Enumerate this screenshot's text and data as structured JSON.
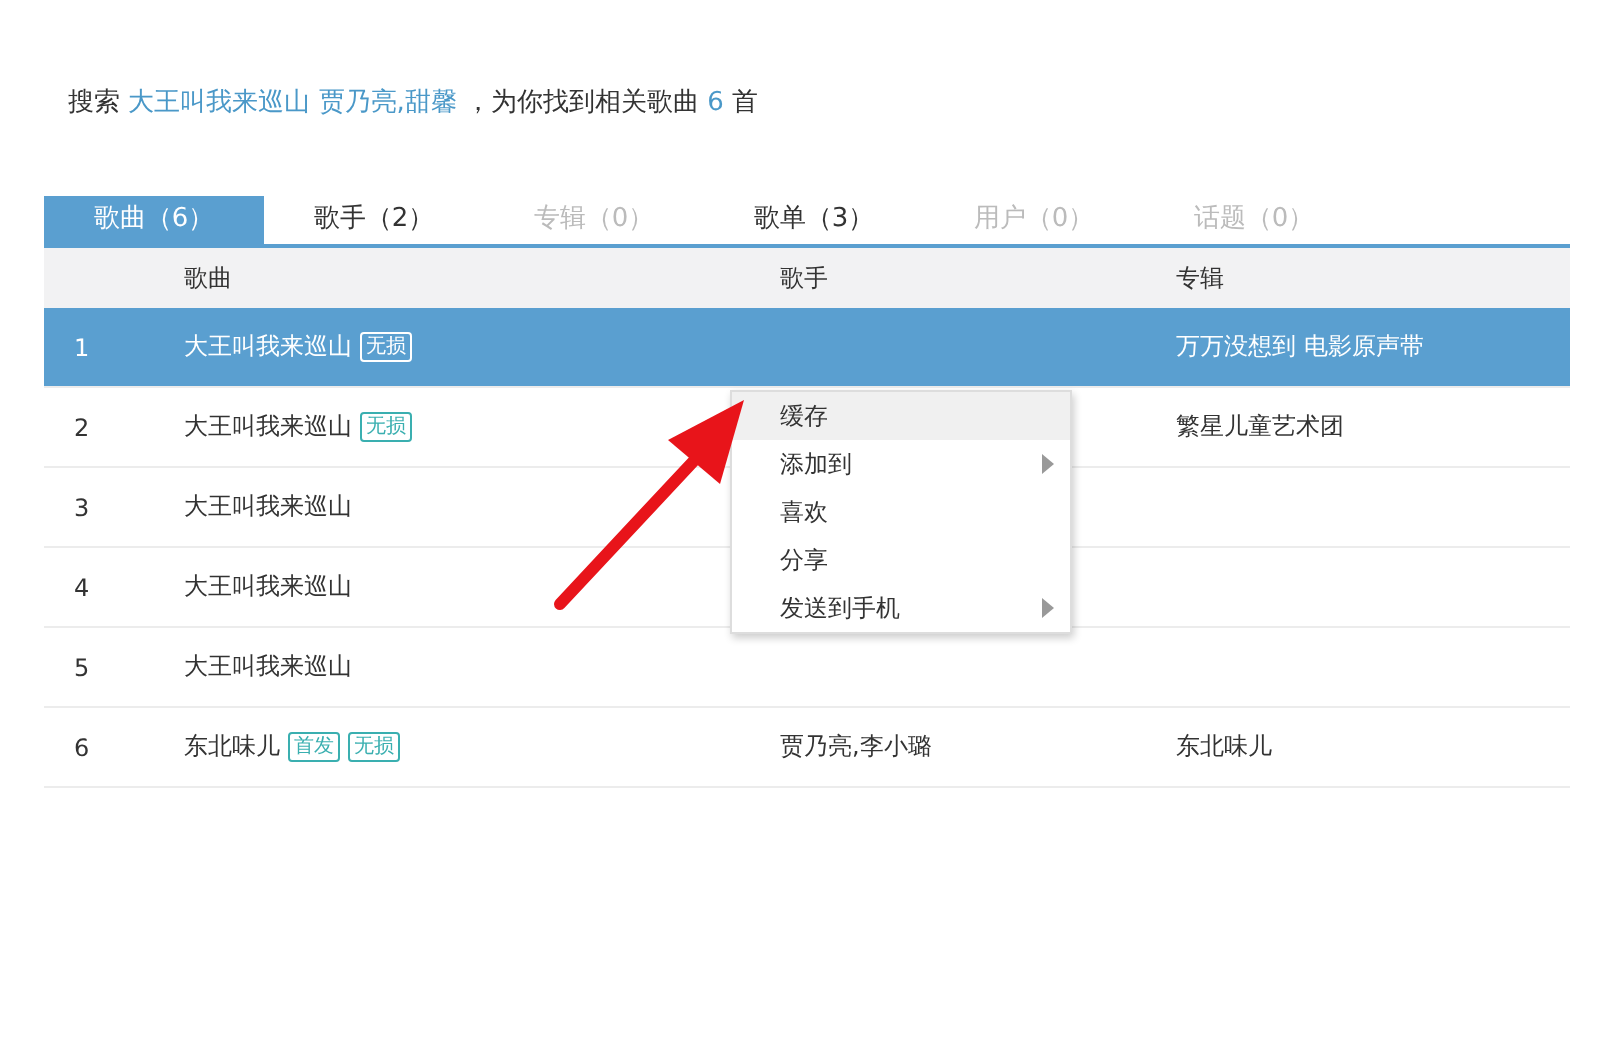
{
  "summary": {
    "prefix": "搜索",
    "query": "大王叫我来巡山 贾乃亮,甜馨",
    "middle": "，为你找到相关歌曲",
    "count": "6",
    "unit": "首"
  },
  "tabs": [
    {
      "label": "歌曲（6）",
      "selected": true,
      "disabled": false
    },
    {
      "label": "歌手（2）",
      "selected": false,
      "disabled": false
    },
    {
      "label": "专辑（0）",
      "selected": false,
      "disabled": true
    },
    {
      "label": "歌单（3）",
      "selected": false,
      "disabled": false
    },
    {
      "label": "用户（0）",
      "selected": false,
      "disabled": true
    },
    {
      "label": "话题（0）",
      "selected": false,
      "disabled": true
    }
  ],
  "table": {
    "columns": [
      "歌曲",
      "歌手",
      "专辑"
    ],
    "rows": [
      {
        "index": "1",
        "song": "大王叫我来巡山",
        "tags": [
          "无损"
        ],
        "album": "万万没想到 电影原声带",
        "selected": true
      },
      {
        "index": "2",
        "song": "大王叫我来巡山",
        "tags": [
          "无损"
        ],
        "album": "繁星儿童艺术团",
        "selected": false
      },
      {
        "index": "3",
        "song": "大王叫我来巡山",
        "tags": [],
        "selected": false
      },
      {
        "index": "4",
        "song": "大王叫我来巡山",
        "tags": [],
        "selected": false
      },
      {
        "index": "5",
        "song": "大王叫我来巡山",
        "tags": [],
        "selected": false
      },
      {
        "index": "6",
        "song": "东北味儿",
        "tags": [
          "首发",
          "无损"
        ],
        "artist": "贾乃亮,李小璐",
        "album": "东北味儿",
        "selected": false
      }
    ]
  },
  "context_menu": {
    "items": [
      {
        "label": "缓存",
        "hovered": true,
        "submenu": false
      },
      {
        "label": "添加到",
        "hovered": false,
        "submenu": true
      },
      {
        "label": "喜欢",
        "hovered": false,
        "submenu": false
      },
      {
        "label": "分享",
        "hovered": false,
        "submenu": false
      },
      {
        "label": "发送到手机",
        "hovered": false,
        "submenu": true
      }
    ]
  }
}
